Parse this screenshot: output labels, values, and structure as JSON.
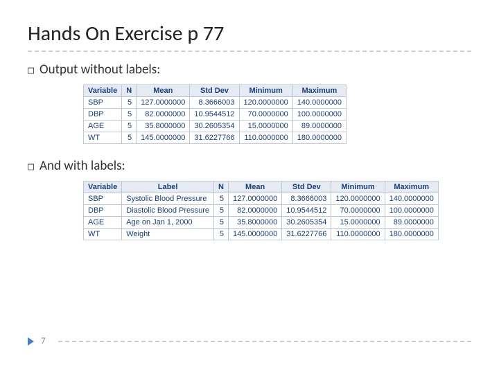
{
  "title": "Hands On Exercise p 77",
  "bullets": {
    "without": "Output without labels:",
    "with": "And with labels:",
    "glyph": "□"
  },
  "tableA": {
    "headers": [
      "Variable",
      "N",
      "Mean",
      "Std Dev",
      "Minimum",
      "Maximum"
    ],
    "rows": [
      [
        "SBP",
        "5",
        "127.0000000",
        "8.3666003",
        "120.0000000",
        "140.0000000"
      ],
      [
        "DBP",
        "5",
        "82.0000000",
        "10.9544512",
        "70.0000000",
        "100.0000000"
      ],
      [
        "AGE",
        "5",
        "35.8000000",
        "30.2605354",
        "15.0000000",
        "89.0000000"
      ],
      [
        "WT",
        "5",
        "145.0000000",
        "31.6227766",
        "110.0000000",
        "180.0000000"
      ]
    ]
  },
  "tableB": {
    "headers": [
      "Variable",
      "Label",
      "N",
      "Mean",
      "Std Dev",
      "Minimum",
      "Maximum"
    ],
    "rows": [
      [
        "SBP",
        "Systolic Blood Pressure",
        "5",
        "127.0000000",
        "8.3666003",
        "120.0000000",
        "140.0000000"
      ],
      [
        "DBP",
        "Diastolic Blood Pressure",
        "5",
        "82.0000000",
        "10.9544512",
        "70.0000000",
        "100.0000000"
      ],
      [
        "AGE",
        "Age on Jan 1, 2000",
        "5",
        "35.8000000",
        "30.2605354",
        "15.0000000",
        "89.0000000"
      ],
      [
        "WT",
        "Weight",
        "5",
        "145.0000000",
        "31.6227766",
        "110.0000000",
        "180.0000000"
      ]
    ]
  },
  "pageNumber": "7"
}
